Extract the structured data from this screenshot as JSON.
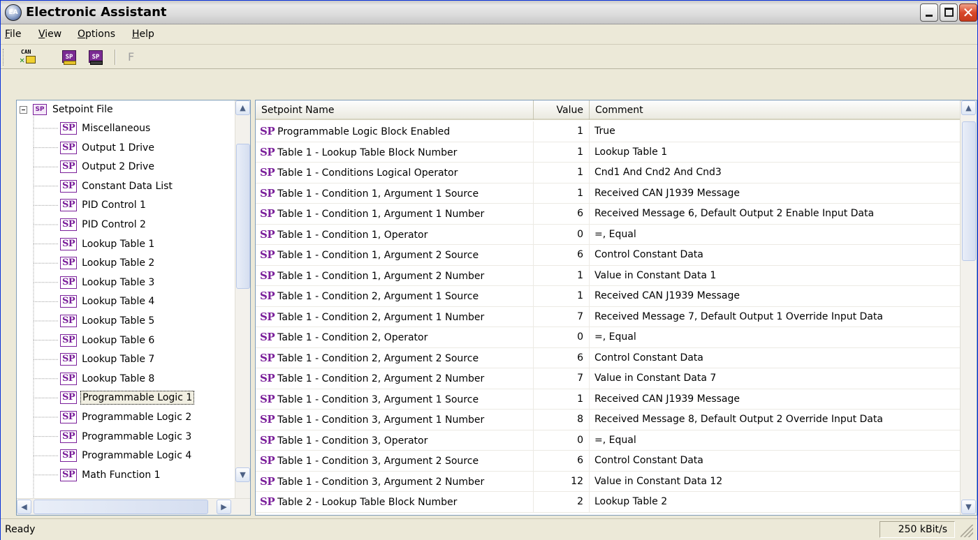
{
  "window": {
    "title": "Electronic Assistant",
    "icon_text": "EA",
    "minimize_label": "",
    "maximize_label": "",
    "close_label": "✕"
  },
  "menu": [
    {
      "label": "File",
      "accel": "F",
      "rest": "ile"
    },
    {
      "label": "View",
      "accel": "V",
      "rest": "iew"
    },
    {
      "label": "Options",
      "accel": "O",
      "rest": "ptions"
    },
    {
      "label": "Help",
      "accel": "H",
      "rest": "elp"
    }
  ],
  "toolbar": {
    "connect_icon_text": "CAN",
    "open_icon_text": "SP",
    "save_icon_text": "SP",
    "disabled_button_label": "F"
  },
  "tree": {
    "root_label": "Setpoint File",
    "root_badge": "SP",
    "badge": "SP",
    "selected_index": 14,
    "items": [
      "Miscellaneous",
      "Output 1 Drive",
      "Output 2 Drive",
      "Constant Data List",
      "PID Control 1",
      "PID Control 2",
      "Lookup Table 1",
      "Lookup Table 2",
      "Lookup Table 3",
      "Lookup Table 4",
      "Lookup Table 5",
      "Lookup Table 6",
      "Lookup Table 7",
      "Lookup Table 8",
      "Programmable Logic 1",
      "Programmable Logic 2",
      "Programmable Logic 3",
      "Programmable Logic 4",
      "Math Function 1"
    ]
  },
  "grid": {
    "columns": {
      "name": "Setpoint Name",
      "value": "Value",
      "comment": "Comment"
    },
    "badge": "SP",
    "rows": [
      {
        "name": "Programmable Logic Block Enabled",
        "value": "1",
        "comment": "True"
      },
      {
        "name": "Table 1 - Lookup Table Block Number",
        "value": "1",
        "comment": "Lookup Table 1"
      },
      {
        "name": "Table 1 - Conditions Logical Operator",
        "value": "1",
        "comment": "Cnd1 And Cnd2 And Cnd3"
      },
      {
        "name": "Table 1 - Condition 1, Argument 1 Source",
        "value": "1",
        "comment": "Received CAN J1939 Message"
      },
      {
        "name": "Table 1 - Condition 1, Argument 1 Number",
        "value": "6",
        "comment": "Received Message 6, Default Output 2 Enable Input Data"
      },
      {
        "name": "Table 1 - Condition 1, Operator",
        "value": "0",
        "comment": "=, Equal"
      },
      {
        "name": "Table 1 - Condition 1, Argument 2 Source",
        "value": "6",
        "comment": "Control Constant Data"
      },
      {
        "name": "Table 1 - Condition 1, Argument 2 Number",
        "value": "1",
        "comment": "Value in Constant Data 1"
      },
      {
        "name": "Table 1 - Condition 2, Argument 1 Source",
        "value": "1",
        "comment": "Received CAN J1939 Message"
      },
      {
        "name": "Table 1 - Condition 2, Argument 1 Number",
        "value": "7",
        "comment": "Received Message 7, Default Output 1 Override Input Data"
      },
      {
        "name": "Table 1 - Condition 2, Operator",
        "value": "0",
        "comment": "=, Equal"
      },
      {
        "name": "Table 1 - Condition 2, Argument 2 Source",
        "value": "6",
        "comment": "Control Constant Data"
      },
      {
        "name": "Table 1 - Condition 2, Argument 2 Number",
        "value": "7",
        "comment": "Value in Constant Data 7"
      },
      {
        "name": "Table 1 - Condition 3, Argument 1 Source",
        "value": "1",
        "comment": "Received CAN J1939 Message"
      },
      {
        "name": "Table 1 - Condition 3, Argument 1 Number",
        "value": "8",
        "comment": "Received Message 8, Default Output 2 Override Input Data"
      },
      {
        "name": "Table 1 - Condition 3, Operator",
        "value": "0",
        "comment": "=, Equal"
      },
      {
        "name": "Table 1 - Condition 3, Argument 2 Source",
        "value": "6",
        "comment": "Control Constant Data"
      },
      {
        "name": "Table 1 - Condition 3, Argument 2 Number",
        "value": "12",
        "comment": "Value in Constant Data 12"
      },
      {
        "name": "Table 2 - Lookup Table Block Number",
        "value": "2",
        "comment": "Lookup Table 2"
      }
    ]
  },
  "status": {
    "text": "Ready",
    "baud_rate": "250 kBit/s"
  },
  "colors": {
    "sp_badge": "#7a1f9a",
    "window_face": "#ece9d8",
    "close_button": "#d9472a"
  }
}
